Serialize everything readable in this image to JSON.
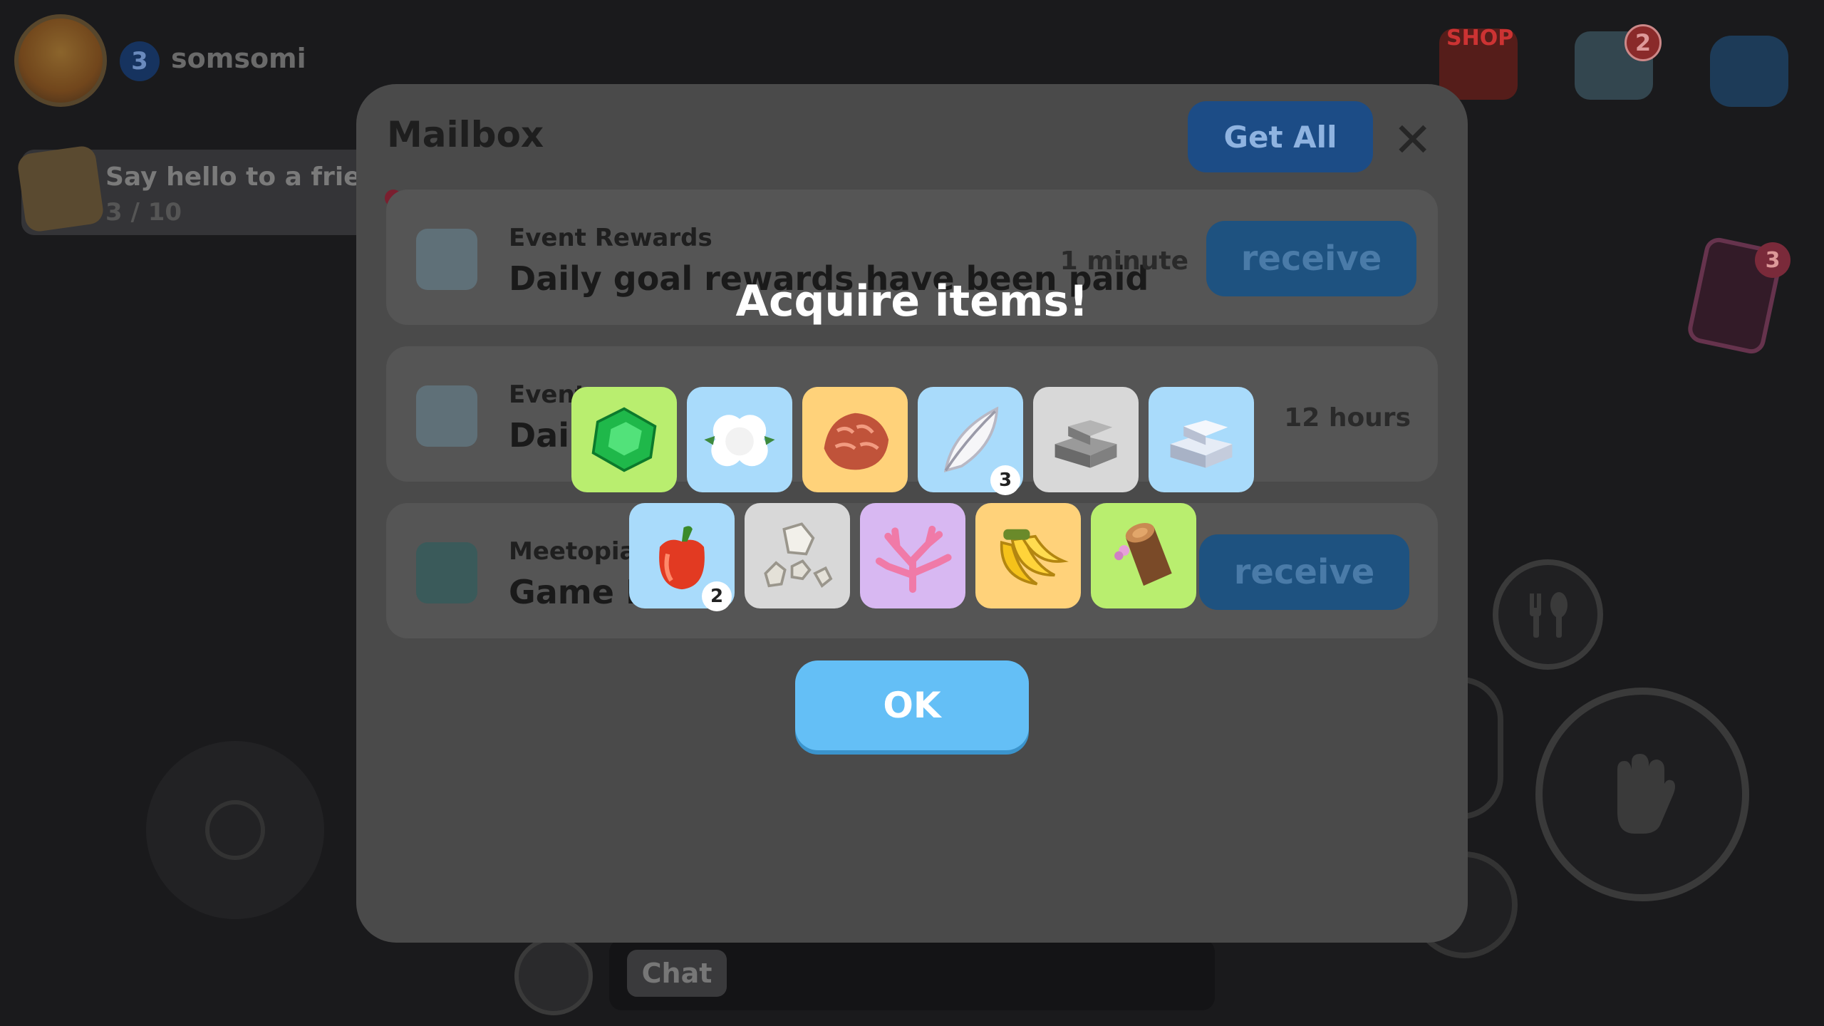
{
  "player": {
    "level": "3",
    "name": "somsomi"
  },
  "quest": {
    "title": "Say hello to a friend",
    "progress": "3 / 10"
  },
  "hud": {
    "shop_label": "SHOP",
    "mail_count": "2",
    "phone_count": "3",
    "chat_label": "Chat"
  },
  "mailbox": {
    "title": "Mailbox",
    "get_all_label": "Get All",
    "rows": [
      {
        "category": "Event Rewards",
        "text": "Daily goal rewards have been paid",
        "time": "1 minute",
        "button": "receive"
      },
      {
        "category": "Event",
        "text": "Dail",
        "time": "12 hours"
      },
      {
        "category": "Meetopia",
        "text": "Game M",
        "button": "receive"
      }
    ]
  },
  "acquire": {
    "title": "Acquire items!",
    "items": [
      {
        "name": "emerald",
        "quantity": "",
        "bg": "#b9ee6f"
      },
      {
        "name": "cotton",
        "quantity": "",
        "bg": "#a9dbfb"
      },
      {
        "name": "fur",
        "quantity": "",
        "bg": "#ffd27a"
      },
      {
        "name": "feather",
        "quantity": "3",
        "bg": "#a9dbfb"
      },
      {
        "name": "iron-ingot",
        "quantity": "",
        "bg": "#d8d8d8"
      },
      {
        "name": "silver-ingot",
        "quantity": "",
        "bg": "#a9dbfb"
      },
      {
        "name": "bell-pepper",
        "quantity": "2",
        "bg": "#a9dbfb"
      },
      {
        "name": "stones",
        "quantity": "",
        "bg": "#d8d8d8"
      },
      {
        "name": "coral",
        "quantity": "",
        "bg": "#d8b8f2"
      },
      {
        "name": "banana",
        "quantity": "",
        "bg": "#ffd27a"
      },
      {
        "name": "log",
        "quantity": "",
        "bg": "#b9ee6f"
      }
    ],
    "ok_label": "OK"
  }
}
